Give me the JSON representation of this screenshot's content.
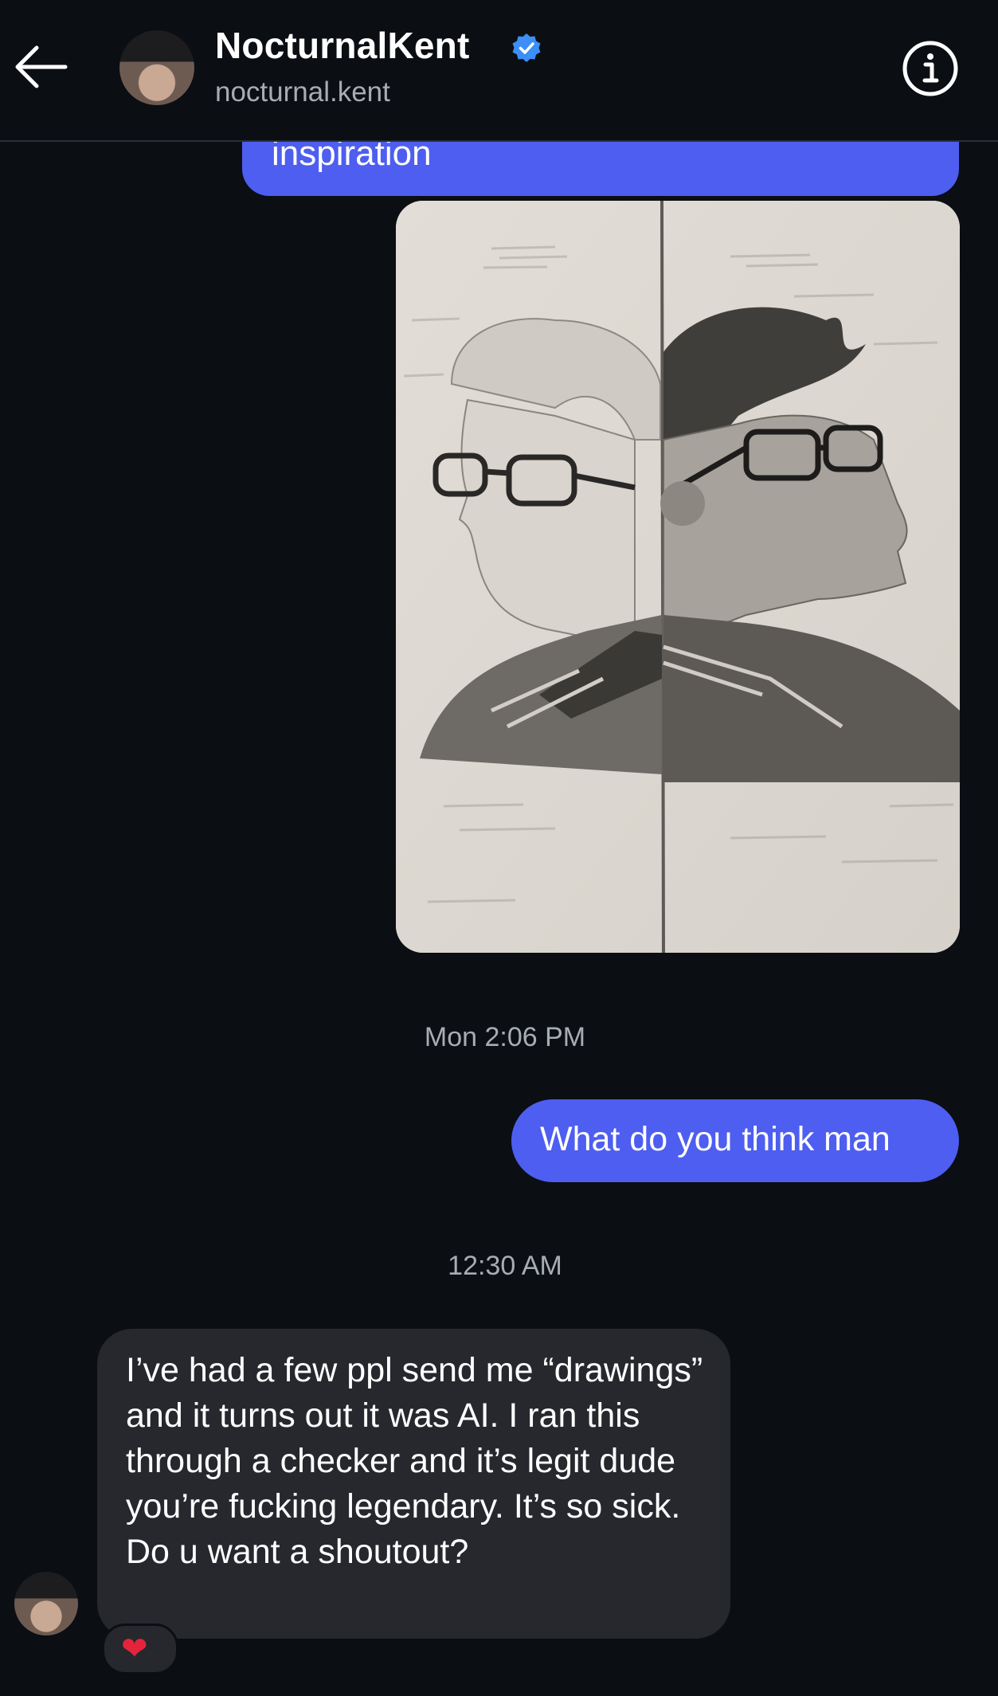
{
  "header": {
    "display_name": "NocturnalKent",
    "handle": "nocturnal.kent"
  },
  "messages": {
    "partial_text": "inspiration",
    "timestamp_1": "Mon 2:06 PM",
    "sent_text": "What do you think man",
    "timestamp_2": "12:30 AM",
    "received_text": "I’ve had a few ppl send me “drawings” and it turns out it was AI. I ran this through a checker and it’s legit dude you’re fucking legendary. It’s so sick. Do u want a shoutout?",
    "reaction": "❤"
  },
  "colors": {
    "background": "#0b0e13",
    "sent_bubble": "#4e5ef0",
    "received_bubble": "#26282e",
    "verified_badge": "#3b8ff6",
    "secondary_text": "#a8acb3"
  },
  "icons": [
    "back-arrow-icon",
    "verified-badge-icon",
    "info-icon",
    "heart-reaction-icon"
  ]
}
